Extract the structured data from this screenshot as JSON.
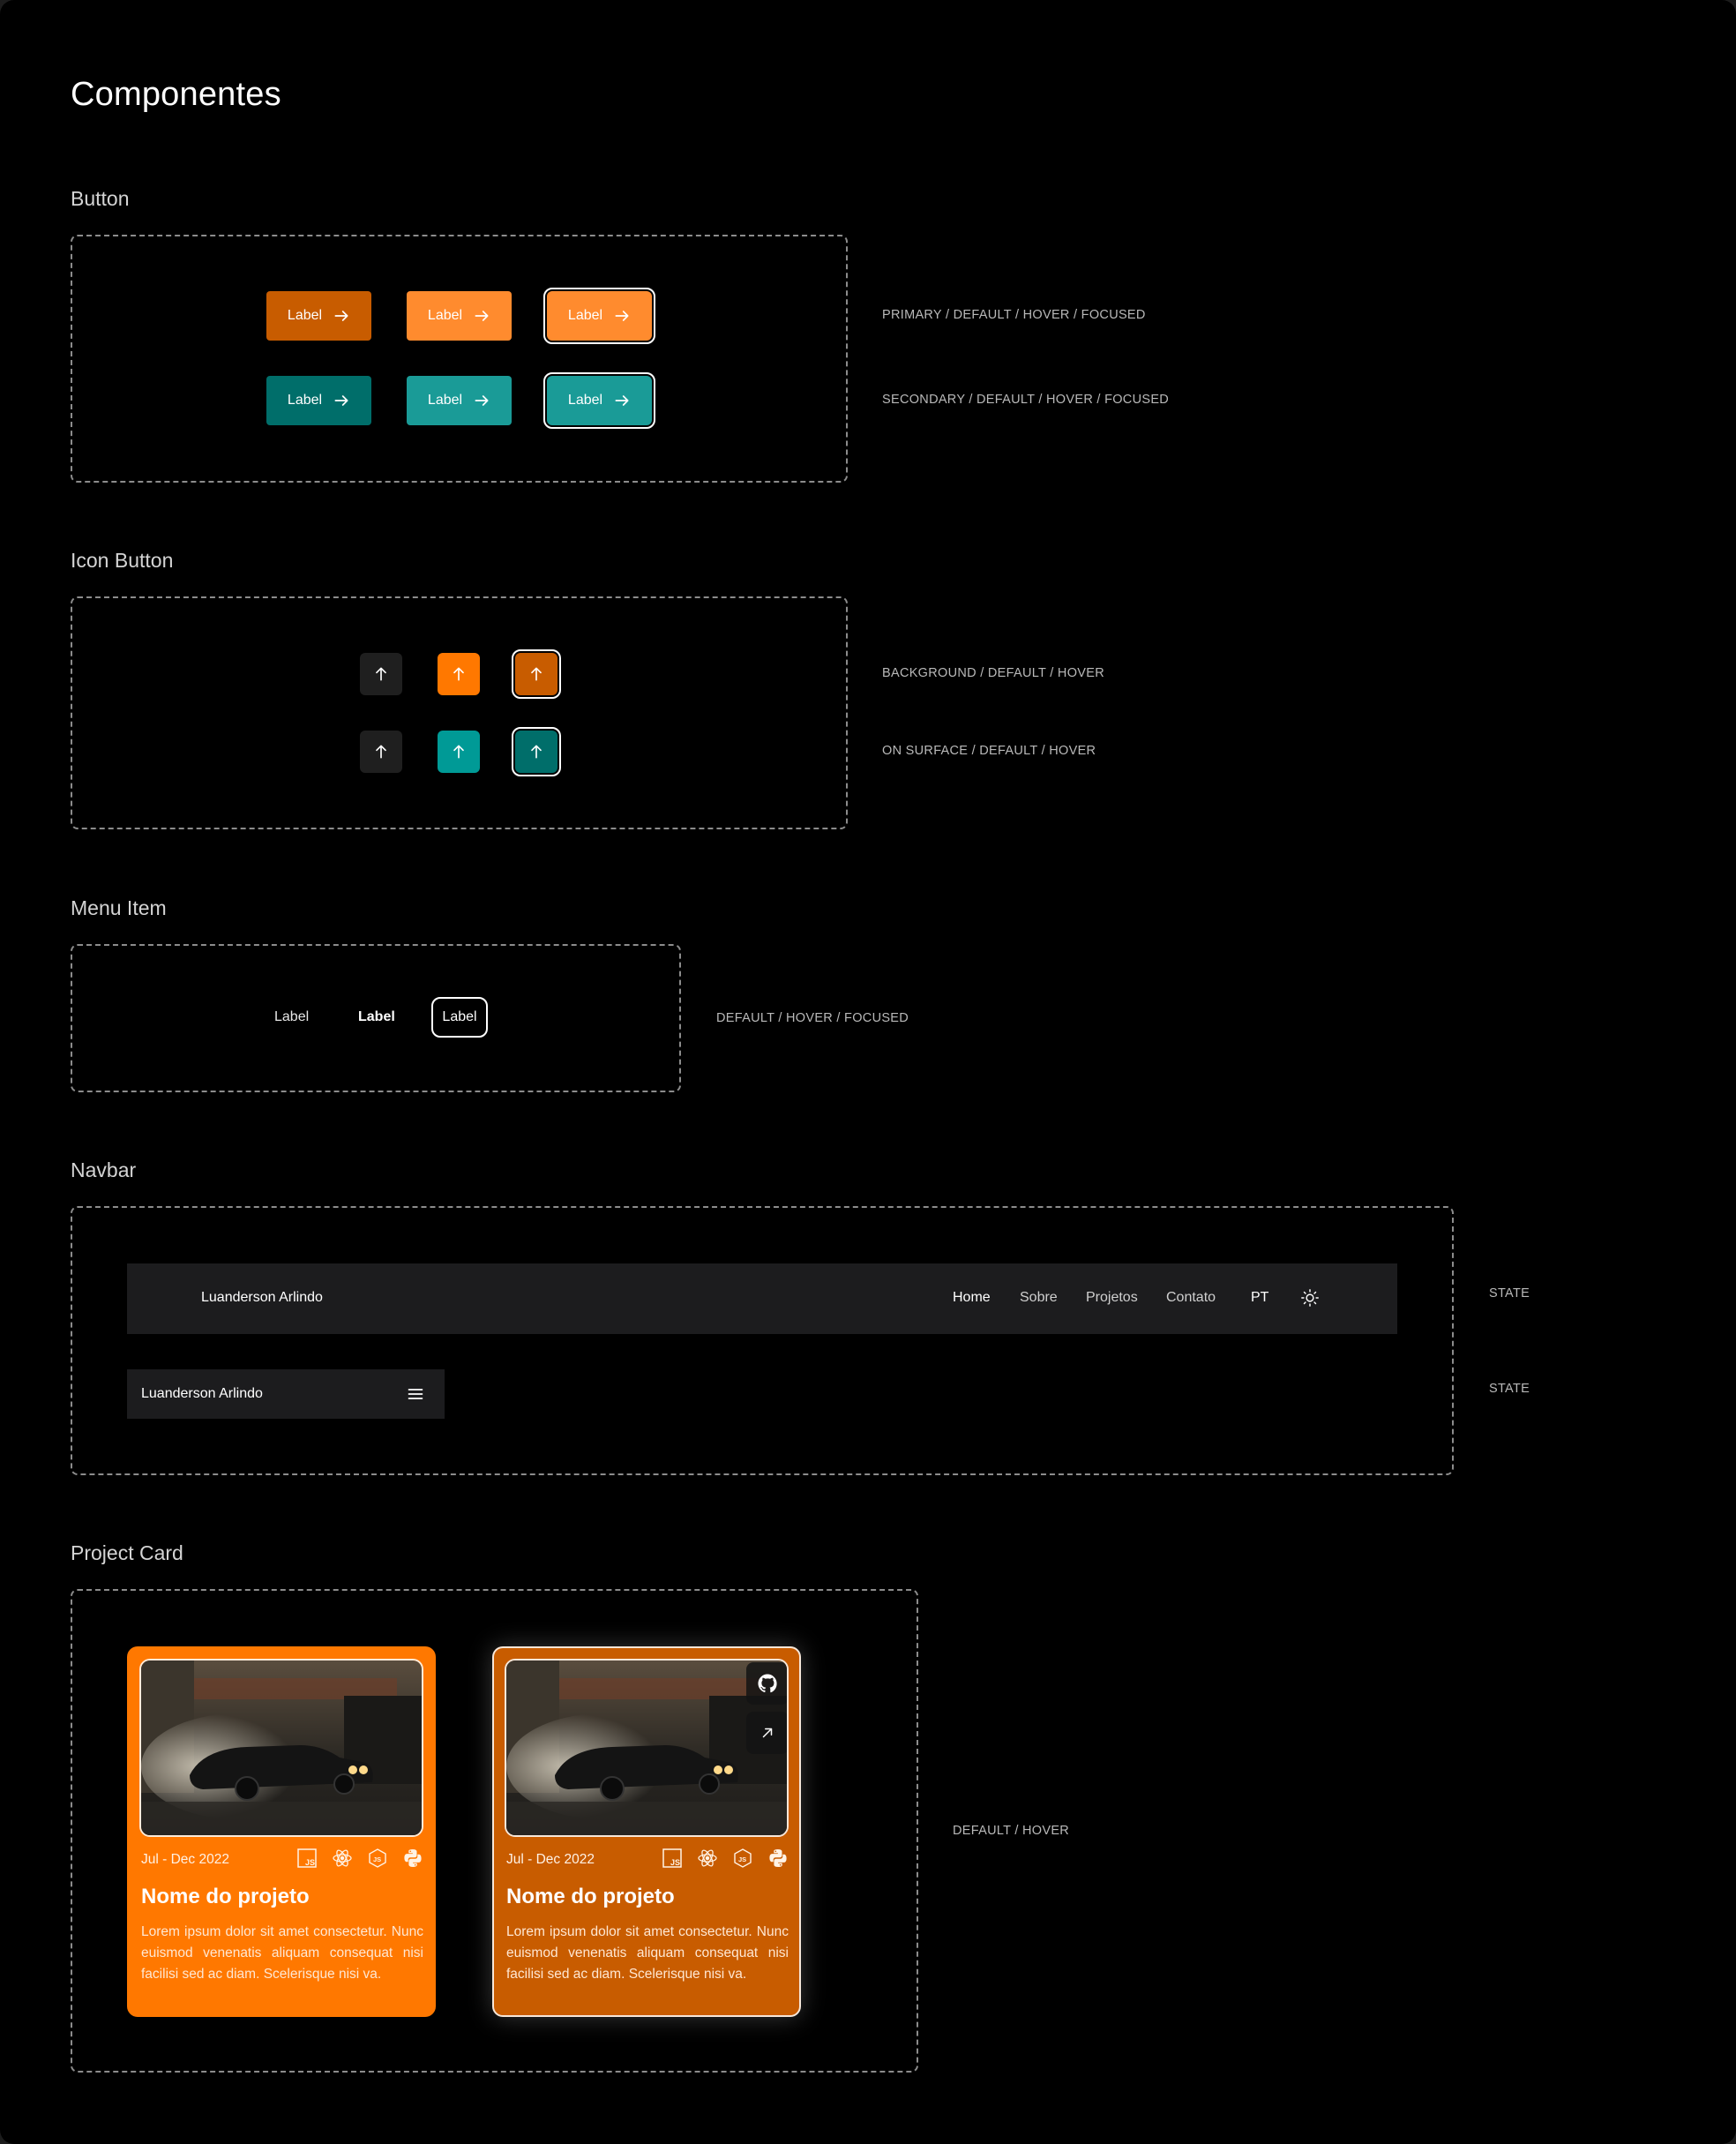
{
  "page": {
    "title": "Componentes"
  },
  "colors": {
    "primary": "#c85c00",
    "primary_hover": "#ff8b2e",
    "secondary": "#006e6a",
    "secondary_hover": "#1a9b97",
    "surface": "#1c1c1e",
    "accent_orange": "#ff7800",
    "accent_teal": "#009a96"
  },
  "button_section": {
    "title": "Button",
    "label": "Label",
    "primary_note": "PRIMARY / DEFAULT / HOVER / FOCUSED",
    "secondary_note": "SECONDARY / DEFAULT / HOVER / FOCUSED",
    "icon": "arrow-right-icon"
  },
  "icon_button_section": {
    "title": "Icon Button",
    "icon": "arrow-up-icon",
    "background_note": "BACKGROUND / DEFAULT /  HOVER",
    "surface_note": "ON SURFACE / DEFAULT / HOVER"
  },
  "menu_item_section": {
    "title": "Menu Item",
    "items": [
      "Label",
      "Label",
      "Label"
    ],
    "note": "DEFAULT /  HOVER / FOCUSED"
  },
  "navbar_section": {
    "title": "Navbar",
    "brand": "Luanderson Arlindo",
    "links": [
      "Home",
      "Sobre",
      "Projetos",
      "Contato"
    ],
    "language": "PT",
    "theme_icon": "sun-icon",
    "menu_icon": "hamburger-menu-icon",
    "state_note_desktop": "STATE",
    "state_note_mobile": "STATE"
  },
  "project_card_section": {
    "title": "Project Card",
    "note": "DEFAULT /  HOVER",
    "cards": [
      {
        "date": "Jul - Dec 2022",
        "title": "Nome do projeto",
        "description": "Lorem ipsum dolor sit amet consectetur. Nunc euismod venenatis aliquam consequat nisi facilisi sed ac diam. Scelerisque nisi va.",
        "tech_icons": [
          "javascript-icon",
          "react-icon",
          "nodejs-icon",
          "python-icon"
        ]
      },
      {
        "date": "Jul - Dec 2022",
        "title": "Nome do projeto",
        "description": "Lorem ipsum dolor sit amet consectetur. Nunc euismod venenatis aliquam consequat nisi facilisi sed ac diam. Scelerisque nisi va.",
        "tech_icons": [
          "javascript-icon",
          "react-icon",
          "nodejs-icon",
          "python-icon"
        ],
        "overlay_icons": [
          "github-icon",
          "external-link-icon"
        ]
      }
    ]
  }
}
